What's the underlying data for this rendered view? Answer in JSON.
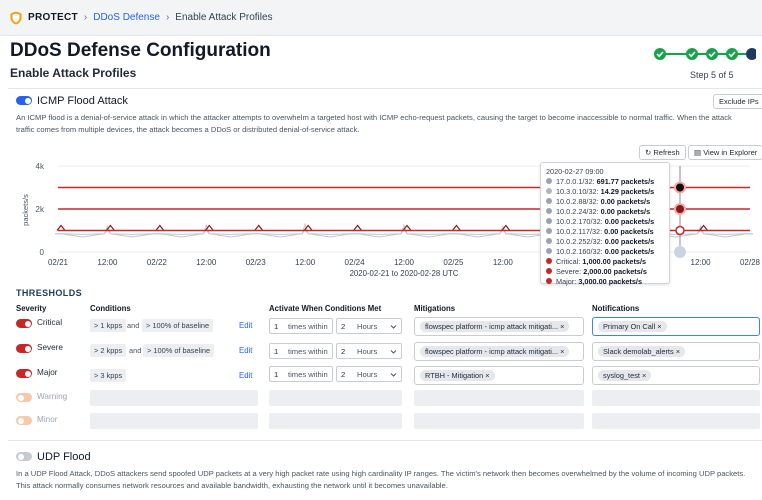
{
  "breadcrumb": {
    "root": "PROTECT",
    "link": "DDoS Defense",
    "current": "Enable Attack Profiles"
  },
  "page": {
    "title": "DDoS Defense Configuration",
    "subtitle": "Enable Attack Profiles",
    "step_text": "Step 5 of 5"
  },
  "colors": {
    "accent": "#2563eb",
    "step_done": "#16a34a",
    "critical": "#c62828",
    "major": "#b71c1c"
  },
  "icmp": {
    "title": "ICMP Flood Attack",
    "enabled": true,
    "exclude_label": "Exclude IPs",
    "description_1": "An ICMP flood is a denial-of-service attack in which the attacker attempts to overwhelm a targeted host with ICMP echo-request packets, causing the target to become inaccessible to normal traffic. When the attack",
    "description_2": "traffic comes from multiple devices, the attack becomes a DDoS or distributed denial-of-service attack.",
    "refresh_label": "Refresh",
    "explorer_label": "View in Explorer"
  },
  "chart_data": {
    "type": "line",
    "ylabel": "packets/s",
    "xlabel": "2020-02-21 to 2020-02-28 UTC",
    "yticks": [
      "0",
      "2k",
      "4k"
    ],
    "ylim": [
      0,
      4000
    ],
    "xticks": [
      "02/21",
      "12:00",
      "02/22",
      "12:00",
      "02/23",
      "12:00",
      "02/24",
      "12:00",
      "02/25",
      "12:00",
      "02/26",
      "12:00",
      "02/27",
      "12:00",
      "02/28"
    ],
    "thresholds": [
      {
        "name": "Critical",
        "value": 1000,
        "color": "#c62828"
      },
      {
        "name": "Severe",
        "value": 2000,
        "color": "#c62828"
      },
      {
        "name": "Major",
        "value": 3000,
        "color": "#c62828"
      }
    ],
    "series": [
      {
        "name": "17.0.0.1/32",
        "values": [
          850,
          1200,
          850,
          1250,
          850,
          1300,
          850,
          1250,
          850,
          1200,
          850,
          1250,
          850,
          1200,
          850
        ]
      },
      {
        "name": "10.3.0.10/32",
        "values": [
          850,
          1050,
          850,
          1050,
          850,
          1050,
          850,
          1050,
          850,
          1050,
          850,
          1050,
          850,
          1050,
          850
        ]
      }
    ]
  },
  "tooltip": {
    "time": "2020-02-27 09:00",
    "rows": [
      {
        "label": "17.0.0.1/32:",
        "value": "691.77 packets/s",
        "color": "#9ca3af"
      },
      {
        "label": "10.3.0.10/32:",
        "value": "14.29 packets/s",
        "color": "#b0b6bd"
      },
      {
        "label": "10.0.2.88/32:",
        "value": "0.00 packets/s",
        "color": "#9ca3af"
      },
      {
        "label": "10.0.2.24/32:",
        "value": "0.00 packets/s",
        "color": "#9ca3af"
      },
      {
        "label": "10.0.2.170/32:",
        "value": "0.00 packets/s",
        "color": "#9ca3af"
      },
      {
        "label": "10.0.2.117/32:",
        "value": "0.00 packets/s",
        "color": "#9ca3af"
      },
      {
        "label": "10.0.2.252/32:",
        "value": "0.00 packets/s",
        "color": "#9ca3af"
      },
      {
        "label": "10.0.2.160/32:",
        "value": "0.00 packets/s",
        "color": "#9ca3af"
      },
      {
        "label": "Critical:",
        "value": "1,000.00 packets/s",
        "color": "#c62828"
      },
      {
        "label": "Severe:",
        "value": "2,000.00 packets/s",
        "color": "#c62828"
      },
      {
        "label": "Major:",
        "value": "3,000.00 packets/s",
        "color": "#c62828"
      }
    ]
  },
  "thresholds": {
    "heading": "THRESHOLDS",
    "col_severity": "Severity",
    "col_conditions": "Conditions",
    "col_activate": "Activate When Conditions Met",
    "col_mitigations": "Mitigations",
    "col_notifications": "Notifications",
    "edit_label": "Edit",
    "and_label": "and",
    "times_within": "times within",
    "hours": "Hours",
    "rows": [
      {
        "severity": "Critical",
        "cond1": "> 1 kpps",
        "cond2": "> 100% of baseline",
        "times": "1",
        "within": "2",
        "mitigation": "flowspec platform - icmp attack mitigati...",
        "notification": "Primary On Call"
      },
      {
        "severity": "Severe",
        "cond1": "> 2 kpps",
        "cond2": "> 100% of baseline",
        "times": "1",
        "within": "2",
        "mitigation": "flowspec platform - icmp attack mitigati...",
        "notification": "Slack demolab_alerts"
      },
      {
        "severity": "Major",
        "cond1": "> 3 kpps",
        "times": "1",
        "within": "2",
        "mitigation": "RTBH - Mitigation",
        "notification": "syslog_test"
      },
      {
        "severity": "Warning"
      },
      {
        "severity": "Minor"
      }
    ]
  },
  "udp": {
    "title": "UDP Flood",
    "enabled": false,
    "description_1": "In a UDP Flood Attack, DDoS attackers send spoofed UDP packets at a very high packet rate using high cardinality IP ranges. The victim's network then becomes overwhelmed by the volume of incoming UDP packets.",
    "description_2": "This attack normally consumes network resources and available bandwidth, exhausting the network until it becomes unavailable."
  }
}
